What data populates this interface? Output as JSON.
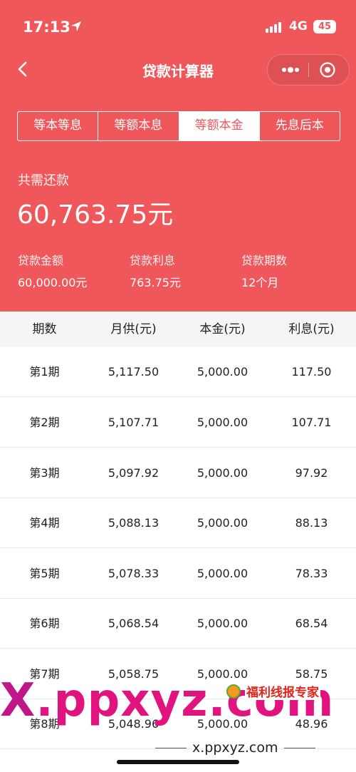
{
  "status_bar": {
    "time": "17:13",
    "network": "4G",
    "battery": "45"
  },
  "nav": {
    "title": "贷款计算器"
  },
  "tabs": [
    {
      "label": "等本等息",
      "active": false
    },
    {
      "label": "等额本息",
      "active": false
    },
    {
      "label": "等额本金",
      "active": true
    },
    {
      "label": "先息后本",
      "active": false
    }
  ],
  "summary": {
    "total_label": "共需还款",
    "total_value": "60,763.75元",
    "items": [
      {
        "label": "贷款金额",
        "value": "60,000.00元"
      },
      {
        "label": "贷款利息",
        "value": "763.75元"
      },
      {
        "label": "贷款期数",
        "value": "12个月"
      }
    ]
  },
  "table": {
    "headers": [
      "期数",
      "月供(元)",
      "本金(元)",
      "利息(元)"
    ],
    "rows": [
      [
        "第1期",
        "5,117.50",
        "5,000.00",
        "117.50"
      ],
      [
        "第2期",
        "5,107.71",
        "5,000.00",
        "107.71"
      ],
      [
        "第3期",
        "5,097.92",
        "5,000.00",
        "97.92"
      ],
      [
        "第4期",
        "5,088.13",
        "5,000.00",
        "88.13"
      ],
      [
        "第5期",
        "5,078.33",
        "5,000.00",
        "78.33"
      ],
      [
        "第6期",
        "5,068.54",
        "5,000.00",
        "68.54"
      ],
      [
        "第7期",
        "5,058.75",
        "5,000.00",
        "58.75"
      ],
      [
        "第8期",
        "5,048.96",
        "5,000.00",
        "48.96"
      ]
    ]
  },
  "watermark": {
    "logo_x": "X",
    "logo_rest": ".ppxyz.com",
    "badge": "福利线报专家",
    "url": "x.ppxyz.com"
  },
  "colors": {
    "brand": "#f0575b",
    "watermark": "#e1147f"
  }
}
